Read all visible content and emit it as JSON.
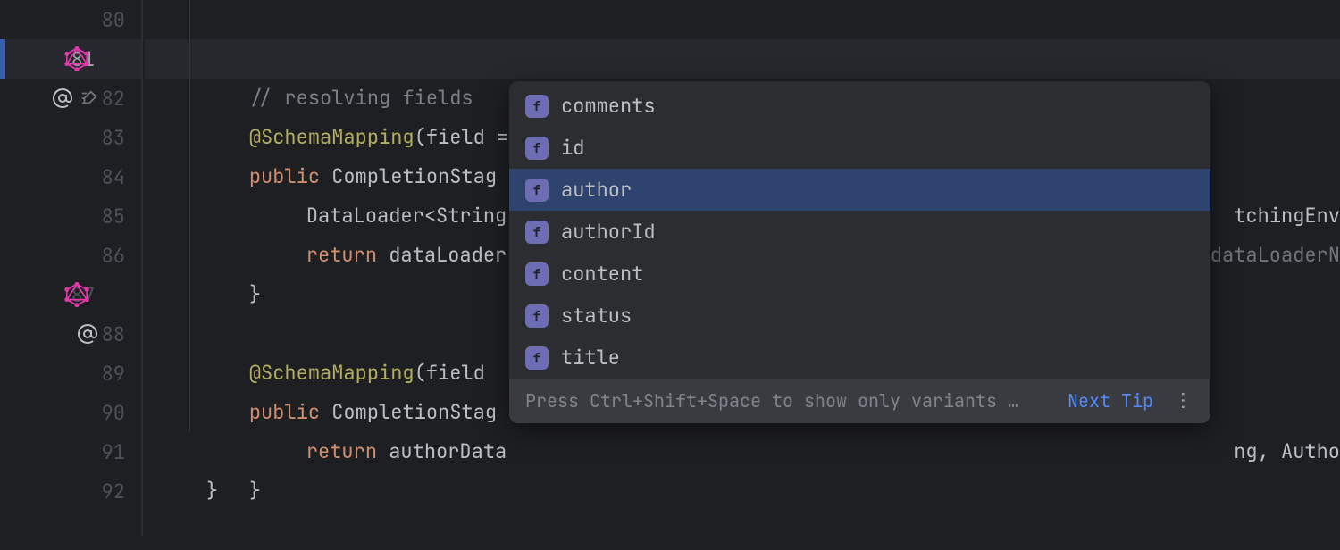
{
  "lines": [
    {
      "num": "80"
    },
    {
      "num": "81"
    },
    {
      "num": "82"
    },
    {
      "num": "83"
    },
    {
      "num": "84"
    },
    {
      "num": "85"
    },
    {
      "num": "86"
    },
    {
      "num": "87"
    },
    {
      "num": "88"
    },
    {
      "num": "89"
    },
    {
      "num": "90"
    },
    {
      "num": "91"
    },
    {
      "num": "92"
    }
  ],
  "code": {
    "l80_comment": "// resolving fields",
    "l81_anno": "@SchemaMapping",
    "l81_field": "field",
    "l81_eq": " = ",
    "l81_str": "\"\"",
    "l82_kw": "public",
    "l82_type": " CompletionStag",
    "l82_tail": "tchingEnv",
    "l83_text": "DataLoader<String",
    "l83_tail": "dataLoaderN",
    "l84_kw": "return",
    "l84_text": " dataLoader",
    "l85_brace": "}",
    "l87_anno": "@SchemaMapping",
    "l87_field": "field",
    "l88_kw": "public",
    "l88_type": " CompletionStag",
    "l88_tail": "ng, Autho",
    "l89_kw": "return",
    "l89_text": " authorData",
    "l90_brace": "}",
    "l91_brace": "}"
  },
  "popup": {
    "icon_letter": "f",
    "items": [
      {
        "label": "comments"
      },
      {
        "label": "id"
      },
      {
        "label": "author"
      },
      {
        "label": "authorId"
      },
      {
        "label": "content"
      },
      {
        "label": "status"
      },
      {
        "label": "title"
      }
    ],
    "footer_hint": "Press Ctrl+Shift+Space to show only variants …",
    "footer_link": "Next Tip",
    "footer_more": "⋮"
  }
}
